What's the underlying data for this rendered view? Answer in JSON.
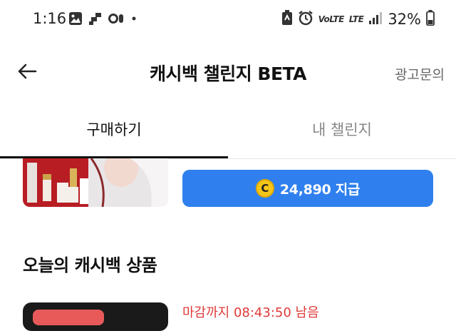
{
  "status_bar": {
    "time": "1:16",
    "network_label": "VoLTE",
    "lte_label": "LTE",
    "battery_percent": "32%",
    "left_icons": [
      "gallery-icon",
      "signal-shape-icon",
      "link-icon",
      "dot-icon"
    ],
    "right_icons": [
      "nfc-icon",
      "alarm-icon",
      "volte-icon",
      "lte-icon",
      "signal-bars-icon",
      "battery-icon"
    ]
  },
  "header": {
    "title": "캐시백 챌린지 BETA",
    "action_label": "광고문의",
    "back_icon": "arrow-left-icon"
  },
  "tabs": [
    {
      "label": "구매하기",
      "active": true
    },
    {
      "label": "내 챌린지",
      "active": false
    }
  ],
  "product": {
    "cashback_label": "24,890 지급",
    "coin_symbol": "C",
    "coin_color": "#f5c518",
    "button_color": "#2f80ee"
  },
  "section": {
    "title": "오늘의 캐시백 상품"
  },
  "next_item": {
    "deadline_text": "마감까지 08:43:50 남음"
  }
}
